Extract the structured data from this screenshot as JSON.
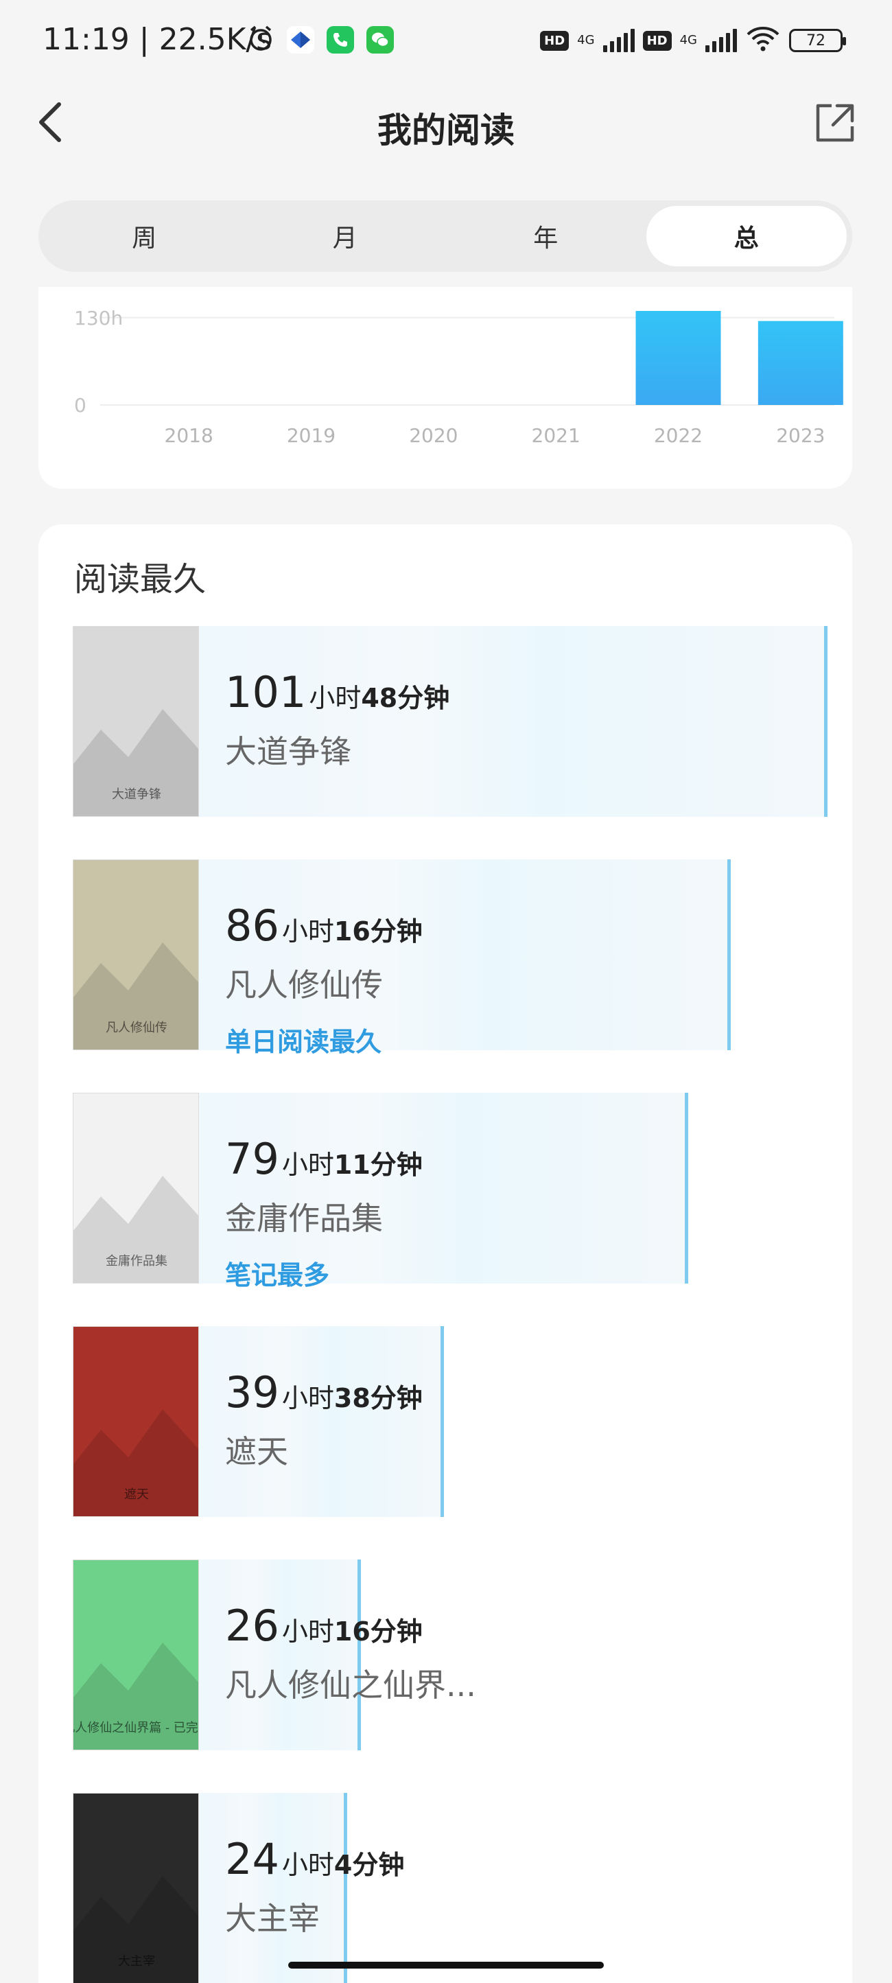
{
  "status_bar": {
    "time": "11:19 | 22.5K/s",
    "net1": "4G",
    "net2": "4G",
    "hd": "HD",
    "battery": "72"
  },
  "header": {
    "title": "我的阅读"
  },
  "tabs": [
    {
      "label": "周",
      "active": false
    },
    {
      "label": "月",
      "active": false
    },
    {
      "label": "年",
      "active": false
    },
    {
      "label": "总",
      "active": true
    }
  ],
  "chart_data": {
    "type": "bar",
    "categories": [
      "2018",
      "2019",
      "2020",
      "2021",
      "2022",
      "2023"
    ],
    "values": [
      0,
      0,
      0,
      0,
      140,
      125
    ],
    "ytick_labels": [
      "0",
      "130h"
    ],
    "ylim": [
      0,
      140
    ],
    "grid": true
  },
  "longest": {
    "title": "阅读最久",
    "books": [
      {
        "hours": "101",
        "hour_unit": "小时",
        "minutes": "48分钟",
        "name": "大道争锋",
        "badge": "",
        "share": 1.0,
        "cover_color": "#d9d9d9",
        "cover_text": "大道争锋"
      },
      {
        "hours": "86",
        "hour_unit": "小时",
        "minutes": "16分钟",
        "name": "凡人修仙传",
        "badge": "单日阅读最久",
        "share": 0.846,
        "cover_color": "#c9c4a8",
        "cover_text": "凡人修仙传"
      },
      {
        "hours": "79",
        "hour_unit": "小时",
        "minutes": "11分钟",
        "name": "金庸作品集",
        "badge": "笔记最多",
        "share": 0.778,
        "cover_color": "#f2f2f2",
        "cover_text": "金庸作品集"
      },
      {
        "hours": "39",
        "hour_unit": "小时",
        "minutes": "38分钟",
        "name": "遮天",
        "badge": "",
        "share": 0.39,
        "cover_color": "#a8322a",
        "cover_text": "遮天"
      },
      {
        "hours": "26",
        "hour_unit": "小时",
        "minutes": "16分钟",
        "name": "凡人修仙之仙界...",
        "badge": "",
        "share": 0.258,
        "cover_color": "#6fd28a",
        "cover_text": "凡人修仙之仙界篇 - 已完…"
      },
      {
        "hours": "24",
        "hour_unit": "小时",
        "minutes": "4分钟",
        "name": "大主宰",
        "badge": "",
        "share": 0.236,
        "cover_color": "#2a2a2a",
        "cover_text": "大主宰"
      }
    ]
  }
}
